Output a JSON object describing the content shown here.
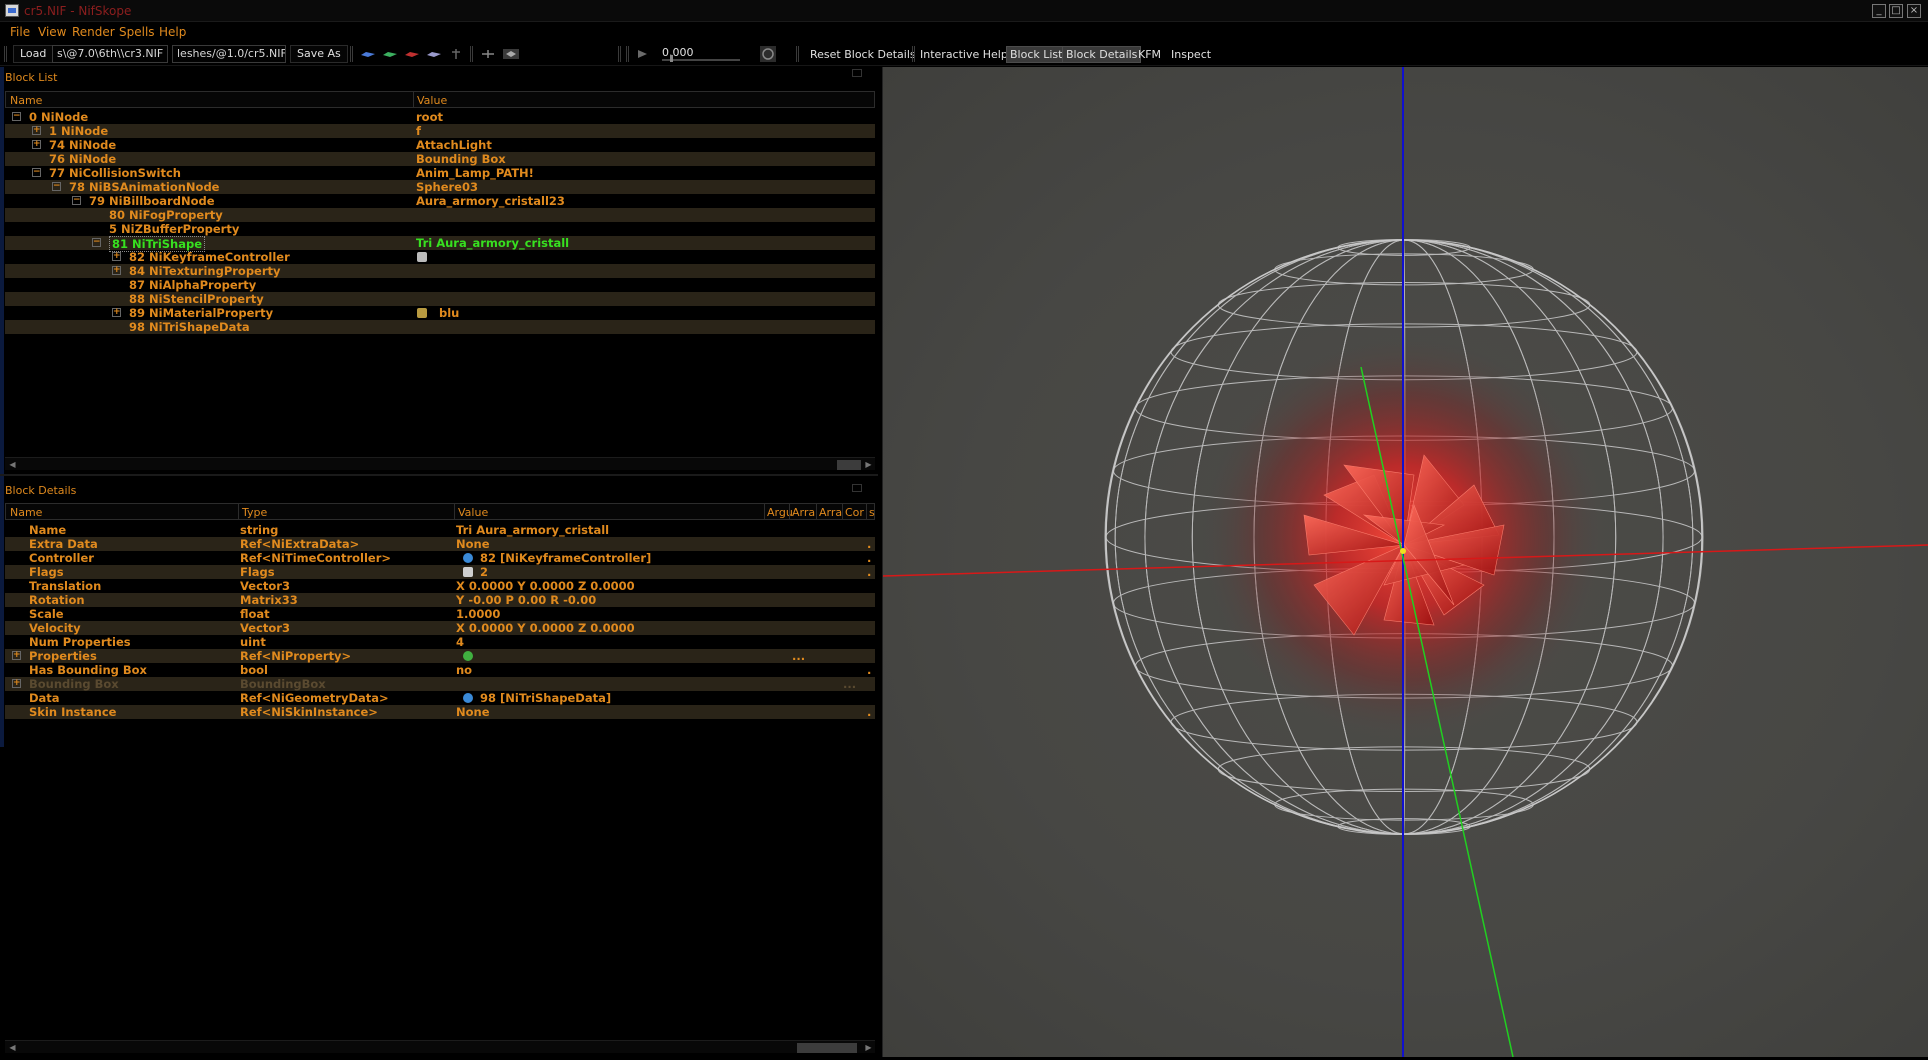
{
  "window": {
    "title": "cr5.NIF - NifSkope",
    "buttons": [
      "_",
      "□",
      "×"
    ]
  },
  "menu": [
    "File",
    "View",
    "Render",
    "Spells",
    "Help"
  ],
  "toolbar": {
    "load_label": "Load",
    "load_path": "s\\@7.0\\6th\\\\cr3.NIF",
    "save_path": "leshes/@1.0/cr5.NIF",
    "save_as_label": "Save As",
    "time_value": "0.000",
    "reset_block_details": "Reset Block Details",
    "interactive_help": "Interactive Help",
    "block_list": "Block List",
    "block_details": "Block Details",
    "kfm": "KFM",
    "inspect": "Inspect"
  },
  "block_list": {
    "title": "Block List",
    "columns": [
      "Name",
      "Value"
    ],
    "rows": [
      {
        "exp": "−",
        "name": "0 NiNode",
        "value": "root"
      },
      {
        "exp": "+",
        "name": "1 NiNode",
        "value": "f"
      },
      {
        "exp": "+",
        "name": "74 NiNode",
        "value": "AttachLight"
      },
      {
        "exp": "",
        "name": "76 NiNode",
        "value": "Bounding Box"
      },
      {
        "exp": "−",
        "name": "77 NiCollisionSwitch",
        "value": "Anim_Lamp_PATH!"
      },
      {
        "exp": "−",
        "name": "78 NiBSAnimationNode",
        "value": "Sphere03"
      },
      {
        "exp": "−",
        "name": "79 NiBillboardNode",
        "value": "Aura_armory_cristall23"
      },
      {
        "exp": "",
        "name": "80 NiFogProperty",
        "value": ""
      },
      {
        "exp": "",
        "name": "5 NiZBufferProperty",
        "value": ""
      },
      {
        "exp": "−",
        "name": "81 NiTriShape",
        "value": "Tri Aura_armory_cristall"
      },
      {
        "exp": "+",
        "name": "82 NiKeyframeController",
        "value": ""
      },
      {
        "exp": "+",
        "name": "84 NiTexturingProperty",
        "value": ""
      },
      {
        "exp": "",
        "name": "87 NiAlphaProperty",
        "value": ""
      },
      {
        "exp": "",
        "name": "88 NiStencilProperty",
        "value": ""
      },
      {
        "exp": "+",
        "name": "89 NiMaterialProperty",
        "value": "blu"
      },
      {
        "exp": "",
        "name": "98 NiTriShapeData",
        "value": ""
      }
    ]
  },
  "block_details": {
    "title": "Block Details",
    "columns": [
      "Name",
      "Type",
      "Value",
      "Argu",
      "Arra",
      "Arra",
      "Cor",
      "s"
    ],
    "rows": [
      {
        "exp": "",
        "name": "Name",
        "type": "string",
        "value": "Tri Aura_armory_cristall",
        "tail": ""
      },
      {
        "exp": "",
        "name": "Extra Data",
        "type": "Ref<NiExtraData>",
        "value": "None",
        "tail": "."
      },
      {
        "exp": "",
        "name": "Controller",
        "type": "Ref<NiTimeController>",
        "value": "82 [NiKeyframeController]",
        "tail": "."
      },
      {
        "exp": "",
        "name": "Flags",
        "type": "Flags",
        "value": "2",
        "tail": "."
      },
      {
        "exp": "",
        "name": "Translation",
        "type": "Vector3",
        "value": "X 0.0000 Y 0.0000 Z 0.0000",
        "tail": ""
      },
      {
        "exp": "",
        "name": "Rotation",
        "type": "Matrix33",
        "value": "Y -0.00 P 0.00 R -0.00",
        "tail": ""
      },
      {
        "exp": "",
        "name": "Scale",
        "type": "float",
        "value": "1.0000",
        "tail": ""
      },
      {
        "exp": "",
        "name": "Velocity",
        "type": "Vector3",
        "value": "X 0.0000 Y 0.0000 Z 0.0000",
        "tail": ""
      },
      {
        "exp": "",
        "name": "Num Properties",
        "type": "uint",
        "value": "4",
        "tail": ""
      },
      {
        "exp": "+",
        "name": "Properties",
        "type": "Ref<NiProperty>",
        "value": "",
        "tail": "..."
      },
      {
        "exp": "",
        "name": "Has Bounding Box",
        "type": "bool",
        "value": "no",
        "tail": "."
      },
      {
        "exp": "+",
        "name": "Bounding Box",
        "type": "BoundingBox",
        "value": "",
        "tail": "..."
      },
      {
        "exp": "",
        "name": "Data",
        "type": "Ref<NiGeometryData>",
        "value": "98 [NiTriShapeData]",
        "tail": ""
      },
      {
        "exp": "",
        "name": "Skin Instance",
        "type": "Ref<NiSkinInstance>",
        "value": "None",
        "tail": "."
      }
    ]
  },
  "colors": {
    "orange_text": "#e08a1e",
    "selected_green": "#37e020",
    "axis_x": "#d81818",
    "axis_y": "#20d020",
    "axis_z": "#1010d0",
    "viewport_bg": "#4a4a47"
  }
}
